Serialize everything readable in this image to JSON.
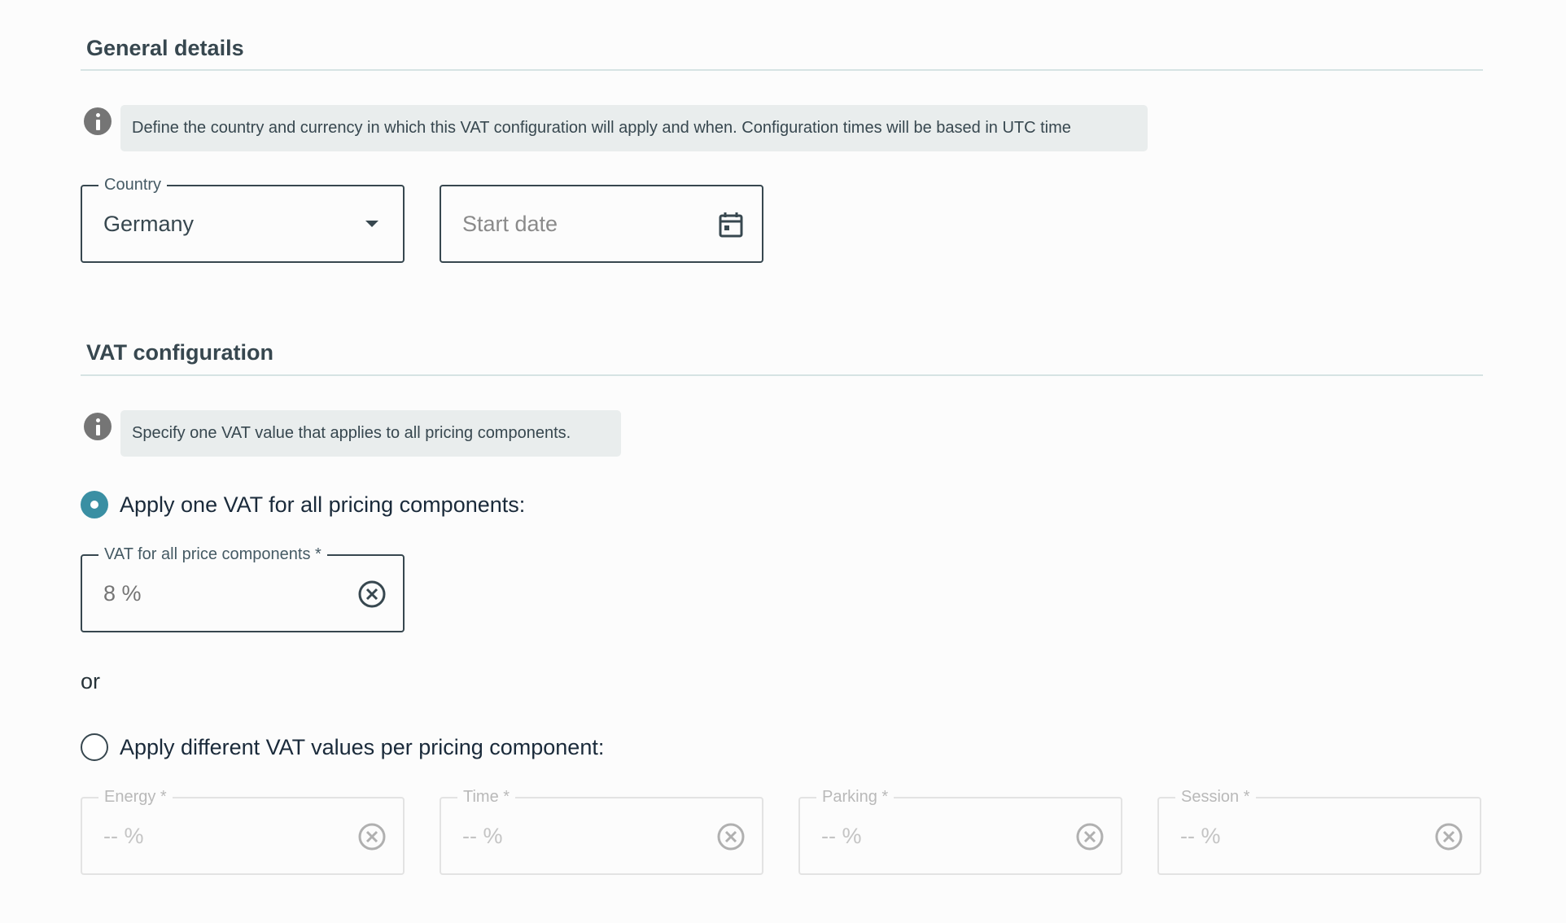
{
  "general": {
    "title": "General details",
    "info_text": "Define the country and currency in which this VAT configuration will apply and when. Configuration times will be based in UTC time",
    "country": {
      "label": "Country",
      "value": "Germany"
    },
    "start_date": {
      "placeholder": "Start date"
    }
  },
  "vat": {
    "title": "VAT configuration",
    "info_text": "Specify one VAT value that applies to all pricing components.",
    "option_single": {
      "label": "Apply one VAT for all pricing components:",
      "selected": true
    },
    "single_field": {
      "label": "VAT for all price components *",
      "value": "8 %"
    },
    "or_text": "or",
    "option_multiple": {
      "label": "Apply different VAT values per pricing component:",
      "selected": false
    },
    "components": [
      {
        "label": "Energy *",
        "value": "-- %"
      },
      {
        "label": "Time *",
        "value": "-- %"
      },
      {
        "label": "Parking *",
        "value": "-- %"
      },
      {
        "label": "Session *",
        "value": "-- %"
      }
    ]
  },
  "colors": {
    "accent": "#3a8fa3",
    "border": "#37474f",
    "banner_bg": "#e9eded",
    "rule": "#d6e3e3"
  },
  "icons": [
    "info-icon",
    "chevron-down-icon",
    "calendar-icon",
    "clear-icon"
  ]
}
